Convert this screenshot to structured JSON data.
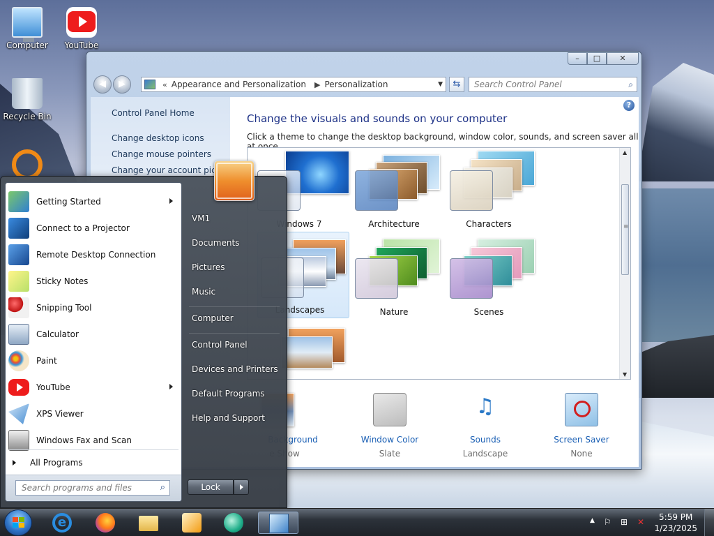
{
  "desktop": {
    "icons": [
      {
        "label": "Computer"
      },
      {
        "label": "YouTube"
      },
      {
        "label": "Recycle Bin"
      }
    ]
  },
  "window": {
    "controls": {
      "minimize": "–",
      "maximize": "□",
      "close": "✕"
    },
    "nav": {
      "back": "◀",
      "forward": "▶"
    },
    "address": {
      "prefix": "«",
      "crumbs": [
        "Appearance and Personalization",
        "Personalization"
      ],
      "sep": "▶"
    },
    "search_placeholder": "Search Control Panel",
    "left_links": [
      "Control Panel Home",
      "Change desktop icons",
      "Change mouse pointers",
      "Change your account pictur"
    ],
    "title": "Change the visuals and sounds on your computer",
    "subtitle": "Click a theme to change the desktop background, window color, sounds, and screen saver all at once.",
    "themes": [
      {
        "label": "Windows 7"
      },
      {
        "label": "Architecture"
      },
      {
        "label": "Characters"
      },
      {
        "label": "Landscapes"
      },
      {
        "label": "Nature"
      },
      {
        "label": "Scenes"
      },
      {
        "label": ""
      }
    ],
    "bottom": [
      {
        "label": "Background",
        "value": "e Show"
      },
      {
        "label": "Window Color",
        "value": "Slate"
      },
      {
        "label": "Sounds",
        "value": "Landscape"
      },
      {
        "label": "Screen Saver",
        "value": "None"
      }
    ]
  },
  "start_menu": {
    "programs": [
      {
        "name": "Getting Started",
        "submenu": true
      },
      {
        "name": "Connect to a Projector",
        "submenu": false
      },
      {
        "name": "Remote Desktop Connection",
        "submenu": false
      },
      {
        "name": "Sticky Notes",
        "submenu": false
      },
      {
        "name": "Snipping Tool",
        "submenu": false
      },
      {
        "name": "Calculator",
        "submenu": false
      },
      {
        "name": "Paint",
        "submenu": false
      },
      {
        "name": "YouTube",
        "submenu": true
      },
      {
        "name": "XPS Viewer",
        "submenu": false
      },
      {
        "name": "Windows Fax and Scan",
        "submenu": false
      }
    ],
    "all_programs": "All Programs",
    "search_placeholder": "Search programs and files",
    "right_items": [
      "VM1",
      "Documents",
      "Pictures",
      "Music",
      "Computer",
      "Control Panel",
      "Devices and Printers",
      "Default Programs",
      "Help and Support"
    ],
    "lock_label": "Lock"
  },
  "taskbar": {
    "time": "5:59 PM",
    "date": "1/23/2025"
  },
  "colors": {
    "link": "#1a5fb4",
    "title": "#1e3287",
    "youtube": "#ee1c1c",
    "accent_orange": "#f08a16"
  }
}
